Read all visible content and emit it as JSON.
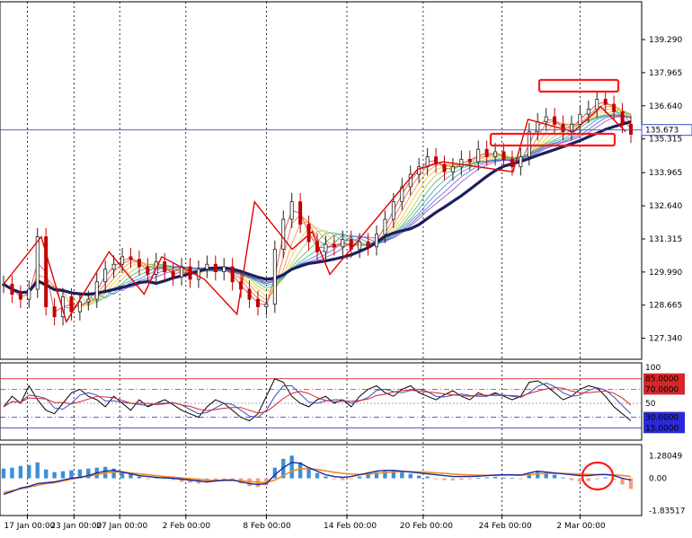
{
  "chart_data": {
    "type": "line",
    "instrument_panel": {
      "price_axis_ticks": [
        "139.290",
        "137.965",
        "136.640",
        "135.315",
        "133.965",
        "132.640",
        "131.315",
        "129.990",
        "128.665",
        "127.340"
      ],
      "price_tick_values": [
        139.29,
        137.965,
        136.64,
        135.315,
        133.965,
        132.64,
        131.315,
        129.99,
        128.665,
        127.34
      ],
      "current_price_label": "135.673",
      "current_price": 135.673,
      "ylim": [
        126.5,
        140.8
      ],
      "close_series": [
        129.5,
        129.1,
        128.9,
        129.3,
        131.4,
        128.6,
        128.2,
        129.0,
        128.4,
        128.8,
        128.9,
        129.6,
        130.1,
        130.3,
        130.6,
        130.5,
        130.2,
        129.9,
        130.4,
        130.0,
        129.8,
        130.2,
        129.7,
        130.1,
        130.3,
        130.0,
        130.2,
        129.6,
        129.3,
        128.9,
        128.6,
        128.7,
        130.9,
        132.1,
        132.8,
        131.9,
        131.2,
        130.8,
        131.1,
        131.0,
        131.3,
        130.9,
        131.2,
        131.0,
        131.5,
        132.1,
        132.8,
        133.4,
        133.9,
        134.2,
        134.6,
        134.3,
        134.0,
        134.2,
        134.5,
        134.4,
        134.9,
        134.6,
        134.8,
        134.5,
        134.2,
        134.6,
        135.6,
        136.0,
        136.2,
        135.9,
        135.6,
        135.9,
        136.3,
        136.5,
        136.9,
        136.7,
        136.4,
        135.9,
        135.5
      ],
      "zigzag_points": [
        [
          0,
          129.5
        ],
        [
          1.5,
          131.4
        ],
        [
          2.5,
          128.0
        ],
        [
          4.2,
          130.8
        ],
        [
          5.6,
          129.1
        ],
        [
          6.3,
          130.6
        ],
        [
          8.0,
          129.7
        ],
        [
          9.3,
          128.3
        ],
        [
          10.0,
          132.8
        ],
        [
          11.5,
          130.9
        ],
        [
          12.3,
          131.6
        ],
        [
          13.0,
          129.9
        ],
        [
          16.5,
          134.1
        ],
        [
          17.5,
          134.4
        ],
        [
          20.3,
          134.0
        ],
        [
          20.9,
          136.1
        ],
        [
          22.7,
          135.6
        ],
        [
          23.8,
          136.6
        ],
        [
          24.8,
          135.6
        ]
      ],
      "resistance_box_label": "",
      "support_box_label": ""
    },
    "stochastic_panel": {
      "scale_max_label": "100",
      "scale_mid_label": "50",
      "levels": [
        {
          "value": 85,
          "label": "85.0000",
          "color": "#d62728"
        },
        {
          "value": 70,
          "label": "70.0000",
          "color": "#d62728"
        },
        {
          "value": 30,
          "label": "30.0000",
          "color": "#2a2ad6"
        },
        {
          "value": 15,
          "label": "15.0000",
          "color": "#2a2ad6"
        }
      ],
      "main_series": [
        45,
        60,
        50,
        75,
        55,
        40,
        35,
        50,
        65,
        70,
        60,
        55,
        45,
        60,
        50,
        40,
        55,
        45,
        50,
        55,
        48,
        40,
        35,
        30,
        45,
        55,
        50,
        40,
        30,
        25,
        35,
        60,
        85,
        80,
        60,
        50,
        45,
        55,
        60,
        50,
        55,
        45,
        60,
        70,
        75,
        65,
        60,
        70,
        75,
        65,
        60,
        55,
        62,
        68,
        60,
        55,
        65,
        60,
        65,
        60,
        55,
        60,
        80,
        82,
        75,
        65,
        55,
        60,
        70,
        75,
        72,
        60,
        45,
        35,
        25
      ]
    },
    "macd_panel": {
      "axis_labels": [
        "1.28049",
        "0.00",
        "-1.83517"
      ],
      "axis_values": [
        1.28049,
        0.0,
        -1.83517
      ],
      "histogram": [
        0.55,
        0.6,
        0.7,
        0.75,
        0.9,
        0.5,
        0.35,
        0.4,
        0.45,
        0.5,
        0.55,
        0.6,
        0.65,
        0.55,
        0.4,
        0.25,
        0.1,
        -0.05,
        0.05,
        0.02,
        -0.1,
        -0.2,
        -0.25,
        -0.3,
        -0.25,
        -0.15,
        -0.05,
        -0.1,
        -0.3,
        -0.45,
        -0.5,
        -0.4,
        0.6,
        1.1,
        1.28,
        0.9,
        0.55,
        0.3,
        0.1,
        -0.05,
        -0.1,
        -0.05,
        0.1,
        0.25,
        0.35,
        0.4,
        0.45,
        0.35,
        0.25,
        0.15,
        0.1,
        -0.05,
        -0.1,
        -0.12,
        -0.08,
        -0.05,
        0.02,
        0.05,
        0.08,
        0.05,
        0.02,
        -0.05,
        0.25,
        0.4,
        0.35,
        0.2,
        0.05,
        -0.1,
        -0.2,
        -0.15,
        -0.05,
        0.05,
        -0.1,
        -0.35,
        -0.6
      ],
      "macd_line": [
        -0.9,
        -0.75,
        -0.55,
        -0.45,
        -0.3,
        -0.25,
        -0.2,
        -0.1,
        0.0,
        0.05,
        0.15,
        0.3,
        0.4,
        0.45,
        0.35,
        0.25,
        0.15,
        0.1,
        0.05,
        0.02,
        0.0,
        -0.05,
        -0.1,
        -0.15,
        -0.2,
        -0.15,
        -0.1,
        -0.1,
        -0.2,
        -0.3,
        -0.35,
        -0.3,
        0.2,
        0.6,
        0.9,
        0.85,
        0.6,
        0.4,
        0.2,
        0.1,
        0.05,
        0.1,
        0.2,
        0.3,
        0.4,
        0.45,
        0.45,
        0.4,
        0.35,
        0.3,
        0.25,
        0.2,
        0.15,
        0.1,
        0.1,
        0.1,
        0.12,
        0.15,
        0.18,
        0.2,
        0.2,
        0.18,
        0.3,
        0.4,
        0.35,
        0.3,
        0.25,
        0.2,
        0.15,
        0.15,
        0.2,
        0.22,
        0.15,
        0.0,
        -0.1
      ],
      "signal_line": [
        -0.8,
        -0.7,
        -0.6,
        -0.5,
        -0.4,
        -0.3,
        -0.25,
        -0.15,
        -0.05,
        0.05,
        0.12,
        0.2,
        0.3,
        0.35,
        0.35,
        0.3,
        0.25,
        0.2,
        0.15,
        0.1,
        0.06,
        0.02,
        -0.02,
        -0.06,
        -0.1,
        -0.12,
        -0.12,
        -0.12,
        -0.14,
        -0.18,
        -0.22,
        -0.24,
        -0.1,
        0.15,
        0.4,
        0.55,
        0.55,
        0.5,
        0.42,
        0.34,
        0.28,
        0.24,
        0.22,
        0.24,
        0.28,
        0.32,
        0.36,
        0.38,
        0.38,
        0.36,
        0.34,
        0.31,
        0.28,
        0.24,
        0.21,
        0.19,
        0.18,
        0.17,
        0.17,
        0.18,
        0.18,
        0.18,
        0.21,
        0.26,
        0.28,
        0.28,
        0.27,
        0.26,
        0.24,
        0.22,
        0.21,
        0.21,
        0.2,
        0.16,
        0.1
      ]
    },
    "x_axis": {
      "tick_labels": [
        "17 Jan 00:00",
        "23 Jan 00:00",
        "27 Jan 00:00",
        "2 Feb 00:00",
        "8 Feb 00:00",
        "14 Feb 00:00",
        "20 Feb 00:00",
        "24 Feb 00:00",
        "2 Mar 00:00"
      ],
      "tick_index": [
        2.8,
        8.3,
        13.7,
        21.5,
        31,
        40.5,
        49.5,
        58.8,
        68
      ]
    }
  }
}
